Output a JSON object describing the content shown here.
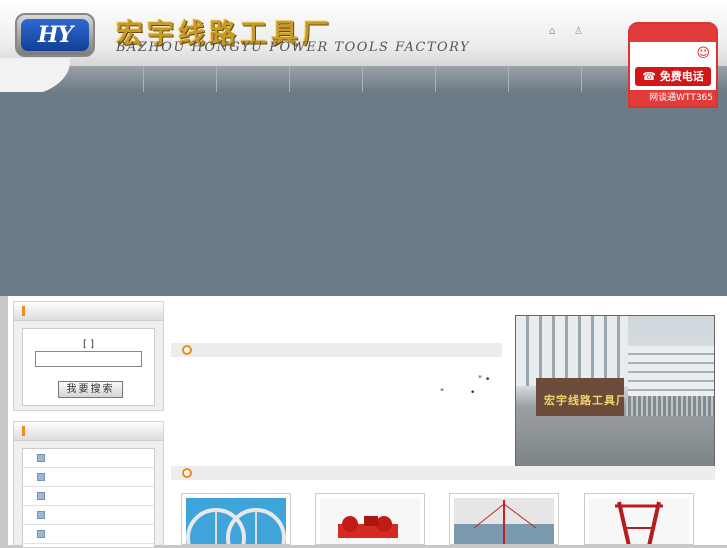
{
  "header": {
    "logo_text": "HY",
    "brand_cn": "宏宇线路工具厂",
    "brand_en": "BAZHOU HONGYU POWER TOOLS FACTORY",
    "icons": [
      "home-icon",
      "user-icon"
    ]
  },
  "phone_widget": {
    "button_label": "☎ 免费电话",
    "footer": "网谈通WTT365",
    "colors": {
      "accent": "#e23b3b"
    }
  },
  "search": {
    "label": "[  ]",
    "input_value": "",
    "button_label": "我要搜索"
  },
  "categories": {
    "rows": 5
  },
  "photo": {
    "gate_text": "宏宇线路工具厂"
  },
  "colors": {
    "banner": "#6d7b86",
    "nav": "#7b868d",
    "accent_orange": "#f08a1c"
  }
}
